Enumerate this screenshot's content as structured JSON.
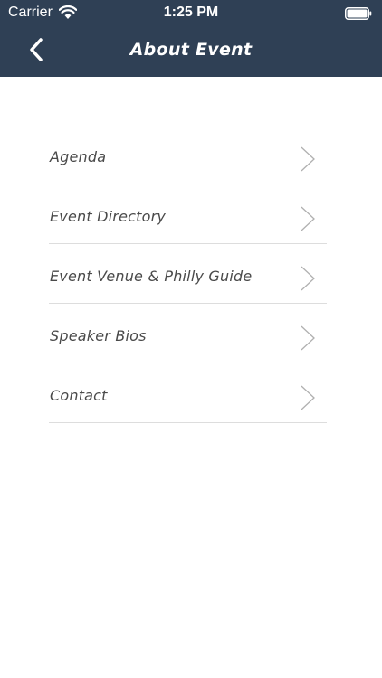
{
  "status_bar": {
    "carrier": "Carrier",
    "time": "1:25 PM",
    "wifi_icon": "wifi-icon",
    "battery_icon": "battery-full-icon"
  },
  "nav": {
    "back_icon": "chevron-left-icon",
    "title": "About Event"
  },
  "menu": {
    "items": [
      {
        "label": "Agenda"
      },
      {
        "label": "Event Directory"
      },
      {
        "label": "Event Venue & Philly Guide"
      },
      {
        "label": "Speaker Bios"
      },
      {
        "label": "Contact"
      }
    ],
    "chevron_icon": "chevron-right-icon"
  },
  "colors": {
    "header_bg": "#2f4055",
    "text": "#4a4a4a",
    "divider": "#dddddd",
    "chevron": "#b0b0b0"
  }
}
